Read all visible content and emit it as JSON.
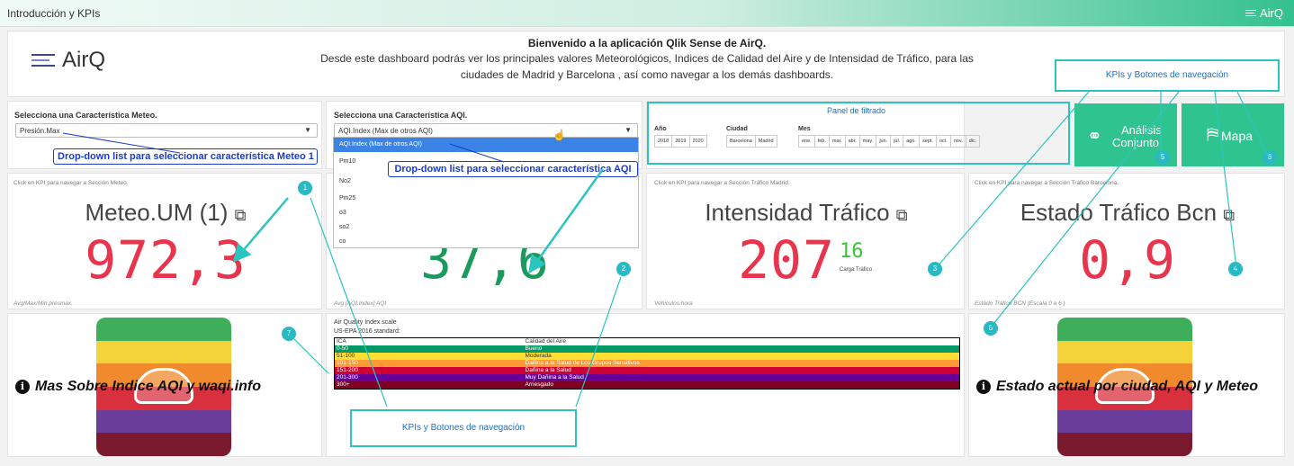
{
  "topbar": {
    "title": "Introducción y KPIs",
    "brand": "AirQ"
  },
  "header": {
    "logo": "AirQ",
    "welcome_title": "Bienvenido a la aplicación Qlik Sense de AirQ.",
    "welcome_line1": "Desde este dashboard podrás ver los principales valores Meteorológicos, Indices de Calidad del Aire y de Intensidad de Tráfico, para las",
    "welcome_line2": "ciudades de Madrid y Barcelona , así como navegar a los demás dashboards."
  },
  "meteo_select": {
    "label": "Selecciona una Característica Meteo.",
    "value": "Presión.Max",
    "annotation": "Drop-down list para seleccionar característica  Meteo 1"
  },
  "aqi_select": {
    "label": "Selecciona una Característica AQI.",
    "value": "AQI.Index (Max de otros AQI)",
    "options": [
      "AQI.Index (Max de otros AQI)",
      "Pm10",
      "No2",
      "Pm25",
      "o3",
      "so2",
      "co"
    ],
    "annotation": "Drop-down list para seleccionar característica  AQI"
  },
  "filter": {
    "title": "Panel de filtrado",
    "year_label": "Año",
    "years": [
      "2018",
      "2019",
      "2020"
    ],
    "city_label": "Ciudad",
    "cities": [
      "Barcelona",
      "Madrid"
    ],
    "month_label": "Mes",
    "months": [
      "ene.",
      "feb.",
      "mar.",
      "abr.",
      "may.",
      "jun.",
      "jul.",
      "ago.",
      "sept.",
      "oct.",
      "nov.",
      "dic."
    ]
  },
  "nav": {
    "annotation_top": "KPIs y Botones de navegación",
    "analysis_label_1": "Análisis",
    "analysis_label_2": "Conjunto",
    "analysis_num": "5",
    "map_label": "Mapa",
    "map_num": "6"
  },
  "kpi_meteo": {
    "note": "Click en KPI para navegar a Sección Meteo.",
    "title": "Meteo.UM (1)",
    "value": "972,3",
    "footer": "Avg/Max/Min.presmax.",
    "num": "1"
  },
  "kpi_aqi": {
    "value": "37,6",
    "footer": "Avg [AQI.Index] AQI",
    "num": "2"
  },
  "kpi_traffic_mad": {
    "note": "Click en KPI para navegar a Sección Tráfico Madrid.",
    "title": "Intensidad Tráfico",
    "value": "207",
    "sub_value": "16",
    "sub_label": "Carga Tráfico",
    "footer": "Vehiculos.hora",
    "num": "3"
  },
  "kpi_traffic_bcn": {
    "note": "Click en KPI para navegar a Sección Tráfico Barcelona.",
    "title": "Estado Tráfico Bcn",
    "value": "0,9",
    "footer": "Estado Tráfico BCN (Escala 0 a 6 )",
    "num": "4"
  },
  "more_aqi": {
    "text": "Mas Sobre Indice AQI y waqi.info",
    "num": "7"
  },
  "aqi_scale": {
    "title1": "Air Quality Index scale",
    "title2": "US-EPA 2016 standard:",
    "header": [
      "ICA",
      "Calidad del Aire"
    ],
    "rows": [
      [
        "0-50",
        "Bueno",
        "#009966",
        "#fff"
      ],
      [
        "51-100",
        "Moderada",
        "#ffde33",
        "#333"
      ],
      [
        "101-150",
        "Dañina a la Salud de Los Grupos Sensitivos",
        "#ff9933",
        "#fff"
      ],
      [
        "151-200",
        "Dañina a la Salud",
        "#cc0033",
        "#fff"
      ],
      [
        "201-300",
        "Muy Dañina a la Salud",
        "#660099",
        "#fff"
      ],
      [
        "300+",
        "Arriesgado",
        "#7e0023",
        "#fff"
      ]
    ],
    "annotation": "KPIs y Botones de navegación"
  },
  "current_state": {
    "text": "Estado actual por ciudad, AQI y Meteo",
    "num": "8"
  },
  "colors": {
    "teal": "#2fc48f",
    "kpi_red": "#e8344d",
    "kpi_green": "#1a9a5c",
    "annotation_blue": "#1a3cc9",
    "annotation_teal": "#2cc4bf"
  }
}
